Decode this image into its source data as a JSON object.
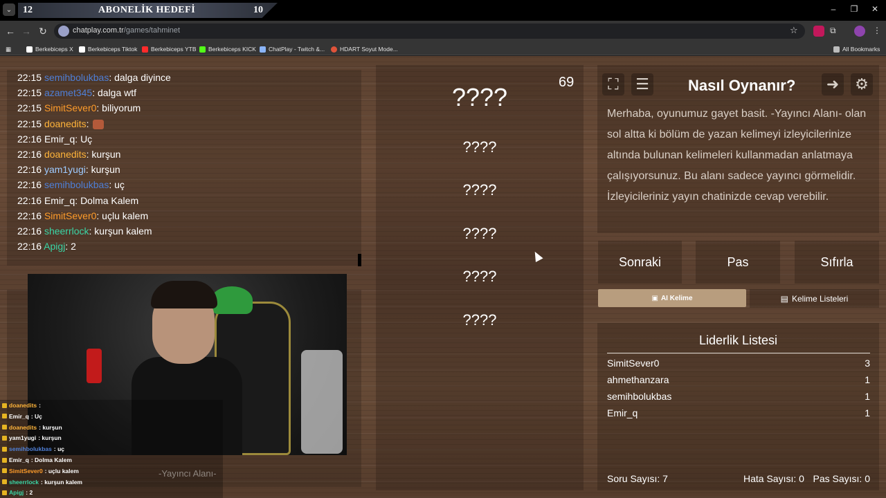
{
  "overlay": {
    "left_count": "12",
    "title": "ABONELİK HEDEFİ",
    "right_count": "10"
  },
  "browser": {
    "url_host": "chatplay.com.tr",
    "url_path": "/games/tahminet",
    "bookmarks": [
      {
        "label": "Berkebiceps X",
        "color": "#ffffff"
      },
      {
        "label": "Berkebiceps Tiktok",
        "color": "#ffffff"
      },
      {
        "label": "Berkebiceps YTB",
        "color": "#ff2b2b"
      },
      {
        "label": "Berkebiceps KICK",
        "color": "#53fc18"
      },
      {
        "label": "ChatPlay - Twitch &...",
        "color": "#8ab4f8"
      },
      {
        "label": "HDART Soyut Mode...",
        "color": "#e0533a"
      }
    ],
    "all_bookmarks": "All Bookmarks"
  },
  "chat": [
    {
      "time": "22:15",
      "user": "semihbolukbas",
      "color": "#4f7fd6",
      "msg": ": dalga diyince"
    },
    {
      "time": "22:15",
      "user": "azamet345",
      "color": "#4f7fd6",
      "msg": ": dalga wtf"
    },
    {
      "time": "22:15",
      "user": "SimitSever0",
      "color": "#ff9c2a",
      "msg": ": biliyorum"
    },
    {
      "time": "22:15",
      "user": "doanedits",
      "color": "#ffb43a",
      "msg": ": "
    },
    {
      "time": "22:16",
      "user": "Emir_q",
      "color": "#ffffff",
      "msg": ": Uç"
    },
    {
      "time": "22:16",
      "user": "doanedits",
      "color": "#ffb43a",
      "msg": ": kurşun"
    },
    {
      "time": "22:16",
      "user": "yam1yugi",
      "color": "#9ecbff",
      "msg": ": kurşun"
    },
    {
      "time": "22:16",
      "user": "semihbolukbas",
      "color": "#4f7fd6",
      "msg": ": uç"
    },
    {
      "time": "22:16",
      "user": "Emir_q",
      "color": "#ffffff",
      "msg": ": Dolma Kalem"
    },
    {
      "time": "22:16",
      "user": "SimitSever0",
      "color": "#ff9c2a",
      "msg": ": uçlu kalem"
    },
    {
      "time": "22:16",
      "user": "sheerrlock",
      "color": "#3ad6a6",
      "msg": ": kurşun kalem"
    },
    {
      "time": "22:16",
      "user": "Apigj",
      "color": "#3ad6a6",
      "msg": ": 2"
    }
  ],
  "overlay_chat": [
    {
      "user": "doanedits",
      "color": "#ffb43a",
      "msg": " : "
    },
    {
      "user": "Emir_q",
      "color": "#ffffff",
      "msg": " : Uç"
    },
    {
      "user": "doanedits",
      "color": "#ffb43a",
      "msg": " : kurşun"
    },
    {
      "user": "yam1yugi",
      "color": "#ffffff",
      "msg": " : kurşun"
    },
    {
      "user": "semihbolukbas",
      "color": "#4f7fd6",
      "msg": " : uç"
    },
    {
      "user": "Emir_q",
      "color": "#ffffff",
      "msg": " : Dolma Kalem"
    },
    {
      "user": "SimitSever0",
      "color": "#ff9c2a",
      "msg": " : uçlu kalem"
    },
    {
      "user": "sheerrlock",
      "color": "#3ad6a6",
      "msg": " : kurşun kalem"
    },
    {
      "user": "Apigj",
      "color": "#3ad6a6",
      "msg": " : 2"
    }
  ],
  "streamer_area_label": "-Yayıncı Alanı-",
  "game": {
    "counter": "69",
    "main_word": "????",
    "hidden_words": [
      "????",
      "????",
      "????",
      "????",
      "????"
    ]
  },
  "info": {
    "title": "Nasıl Oynanır?",
    "body": "Merhaba, oyunumuz gayet basit. -Yayıncı Alanı- olan sol altta ki bölüm de yazan kelimeyi izleyicilerinize altında bulunan kelimeleri kullanmadan anlatmaya çalışıyorsunuz. Bu alanı sadece yayıncı görmelidir. İzleyicileriniz yayın chatinizde cevap verebilir."
  },
  "buttons": {
    "next": "Sonraki",
    "pass": "Pas",
    "reset": "Sıfırla",
    "ai_word": "AI Kelime",
    "word_lists": "Kelime Listeleri"
  },
  "leaderboard": {
    "title": "Liderlik Listesi",
    "rows": [
      {
        "name": "SimitSever0",
        "score": "3"
      },
      {
        "name": "ahmethanzara",
        "score": "1"
      },
      {
        "name": "semihbolukbas",
        "score": "1"
      },
      {
        "name": "Emir_q",
        "score": "1"
      }
    ],
    "questions_label": "Soru Sayısı: 7",
    "errors_label": "Hata Sayısı: 0",
    "passes_label": "Pas Sayısı: 0"
  }
}
